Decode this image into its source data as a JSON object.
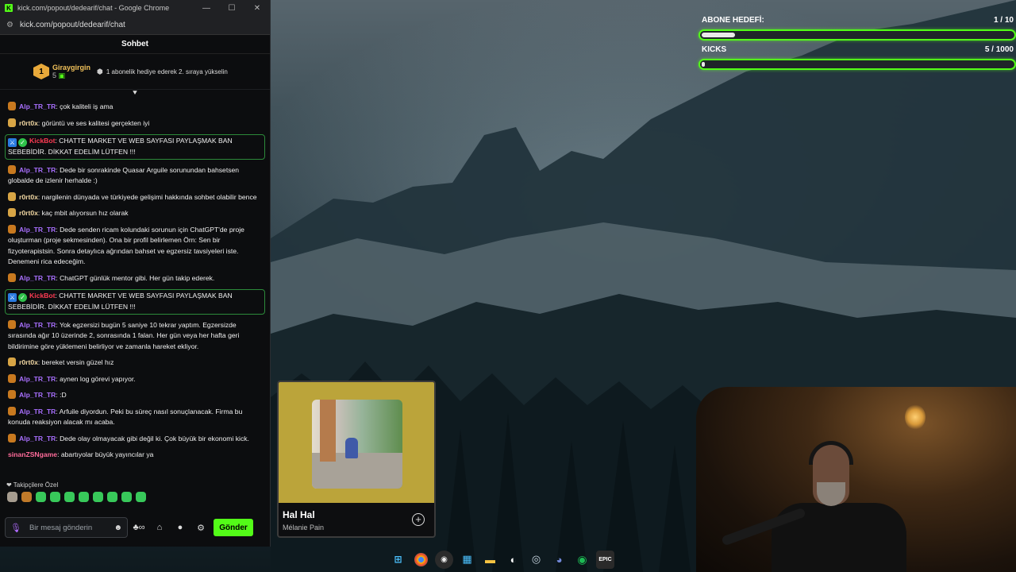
{
  "browser": {
    "window_title": "kick.com/popout/dedearif/chat - Google Chrome",
    "url": "kick.com/popout/dedearif/chat",
    "minimize_icon": "—",
    "maximize_icon": "☐",
    "close_icon": "✕"
  },
  "chat": {
    "header": "Sohbet",
    "pinned": {
      "rank": "1",
      "username": "Giraygirgin",
      "count": "5",
      "gift_text": "1 abonelik hediye ederek 2. sıraya yükselin"
    },
    "messages": [
      {
        "user": "Alp_TR_TR",
        "kind": "alp",
        "text": ": çok kaliteli iş ama"
      },
      {
        "user": "r0rt0x",
        "kind": "r0",
        "text": ": görüntü ve ses kalitesi gerçekten iyi"
      },
      {
        "user": "KickBot",
        "kind": "bot",
        "text": ": CHATTE MARKET VE WEB SAYFASI PAYLAŞMAK BAN SEBEBİDİR. DİKKAT EDELİM LÜTFEN !!!"
      },
      {
        "user": "Alp_TR_TR",
        "kind": "alp",
        "text": ": Dede bir sonrakinde Quasar Arguile sorunundan bahsetsen globalde de izlenir herhalde :)"
      },
      {
        "user": "r0rt0x",
        "kind": "r0",
        "text": ": nargilenin dünyada ve türkiyede gelişimi hakkında sohbet olabilir bence"
      },
      {
        "user": "r0rt0x",
        "kind": "r0",
        "text": ": kaç mbit alıyorsun hız olarak"
      },
      {
        "user": "Alp_TR_TR",
        "kind": "alp",
        "text": ": Dede senden ricam kolundaki sorunun için ChatGPT'de proje oluşturman (proje sekmesinden). Ona bir profil belirlemen Örn: Sen bir fizyoterapistsin. Sonra detaylıca ağrından bahset ve egzersiz tavsiyeleri iste. Denemeni rica edeceğim."
      },
      {
        "user": "Alp_TR_TR",
        "kind": "alp",
        "text": ": ChatGPT günlük mentor gibi. Her gün takip ederek."
      },
      {
        "user": "KickBot",
        "kind": "bot",
        "text": ": CHATTE MARKET VE WEB SAYFASI PAYLAŞMAK BAN SEBEBİDİR. DİKKAT EDELİM LÜTFEN !!!"
      },
      {
        "user": "Alp_TR_TR",
        "kind": "alp",
        "text": ": Yok egzersizi bugün 5 saniye 10 tekrar yaptım. Egzersizde sırasında ağır 10 üzerinde 2, sonrasında 1 falan. Her gün veya her hafta geri bildirimine göre yüklemeni belirliyor ve zamanla hareket ekliyor."
      },
      {
        "user": "r0rt0x",
        "kind": "r0",
        "text": ": bereket versin güzel hız"
      },
      {
        "user": "Alp_TR_TR",
        "kind": "alp",
        "text": ": aynen log görevi yapıyor."
      },
      {
        "user": "Alp_TR_TR",
        "kind": "alp",
        "text": ": :D"
      },
      {
        "user": "Alp_TR_TR",
        "kind": "alp",
        "text": ": Arfuile diyordun. Peki bu süreç nasıl sonuçlanacak. Firma bu konuda reaksiyon alacak mı acaba."
      },
      {
        "user": "Alp_TR_TR",
        "kind": "alp",
        "text": ": Dede olay olmayacak gibi değil ki. Çok büyük bir ekonomi kick."
      },
      {
        "user": "sinanZSNgame",
        "kind": "sinan",
        "text": ": abartıyolar büyük yayıncılar ya"
      }
    ],
    "followers_label": "Takipçilere Özel",
    "input_placeholder": "Bir mesaj gönderin",
    "send_label": "Gönder"
  },
  "goals": [
    {
      "label": "ABONE HEDEFİ:",
      "progress": "1 / 10",
      "fill_fraction": 0.1
    },
    {
      "label": "KICKS",
      "progress": "5 / 1000",
      "fill_fraction": 0.005
    }
  ],
  "music": {
    "title": "Hal Hal",
    "artist": "Mélanie Pain"
  },
  "taskbar": {
    "epic_label": "EPIC"
  },
  "colors": {
    "kick_green": "#53fc18",
    "alp_purple": "#a970ff",
    "kickbot_red": "#ff3b53"
  }
}
